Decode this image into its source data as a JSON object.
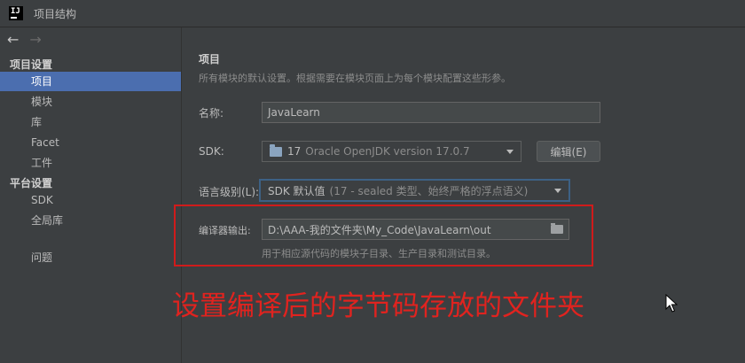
{
  "window": {
    "logo": "IJ",
    "title": "项目结构"
  },
  "nav": {
    "back": "←",
    "forward": "→"
  },
  "sidebar": {
    "section_project": "项目设置",
    "section_platform": "平台设置",
    "items": [
      {
        "label": "项目",
        "selected": true
      },
      {
        "label": "模块"
      },
      {
        "label": "库"
      },
      {
        "label": "Facet"
      },
      {
        "label": "工件"
      }
    ],
    "platform_items": [
      {
        "label": "SDK"
      },
      {
        "label": "全局库"
      }
    ],
    "problems": "问题"
  },
  "main": {
    "title": "项目",
    "description": "所有模块的默认设置。根据需要在模块页面上为每个模块配置这些形参。",
    "name_label": "名称:",
    "name_value": "JavaLearn",
    "sdk_label": "SDK:",
    "sdk_version": "17",
    "sdk_name": "Oracle OpenJDK version 17.0.7",
    "edit_button": "编辑(E)",
    "language_label": "语言级别(L):",
    "language_value": "SDK 默认值",
    "language_detail": "(17 - sealed 类型、始终严格的浮点语义)",
    "compiler_output_label": "编译器输出:",
    "compiler_output_value": "D:\\AAA-我的文件夹\\My_Code\\JavaLearn\\out",
    "compiler_output_hint": "用于相应源代码的模块子目录、生产目录和测试目录。"
  },
  "annotation": {
    "text": "设置编译后的字节码存放的文件夹",
    "color": "#e0231f"
  },
  "colors": {
    "background": "#3c3f41",
    "selection": "#4b6eaf",
    "highlight_box": "#d01b1b"
  }
}
